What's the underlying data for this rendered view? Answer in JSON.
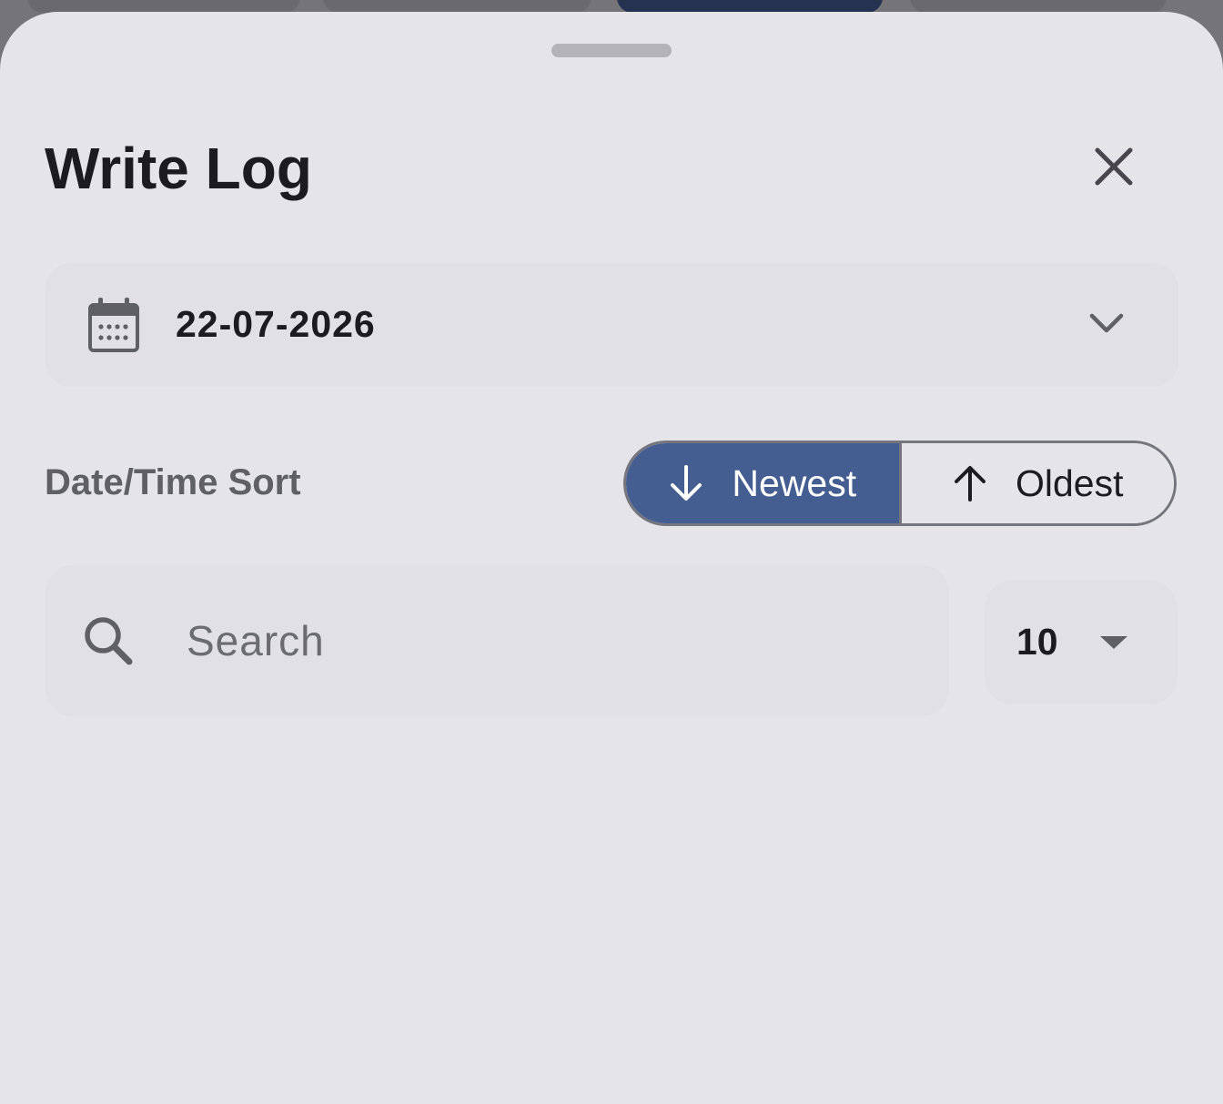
{
  "sheet": {
    "title": "Write Log"
  },
  "date_picker": {
    "value": "22-07-2026",
    "icon": "calendar-icon",
    "expand_icon": "chevron-down-icon"
  },
  "sort": {
    "label": "Date/Time Sort",
    "options": [
      {
        "label": "Newest",
        "icon": "arrow-down-icon",
        "selected": true
      },
      {
        "label": "Oldest",
        "icon": "arrow-up-icon",
        "selected": false
      }
    ]
  },
  "search": {
    "placeholder": "Search",
    "value": "",
    "icon": "search-icon"
  },
  "page_size": {
    "value": "10",
    "icon": "caret-down-icon"
  },
  "colors": {
    "sheet_bg": "#e5e4e9",
    "field_bg": "#e1e0e6",
    "accent": "#445e91",
    "text": "#1c1b1f",
    "muted_text": "#5f5f66"
  }
}
